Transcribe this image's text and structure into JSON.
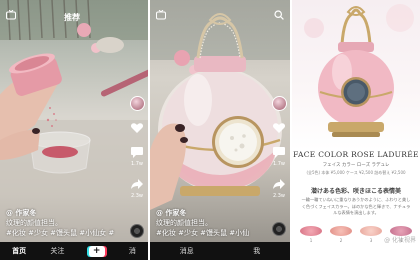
{
  "video1": {
    "top_tab_left": "推荐",
    "caption_author": "@ 作家冬",
    "caption_line1": "纹理的颜值担当。",
    "caption_tags": "#化妆 #少女 #馒头鼠 #小仙女 #",
    "comment_count": "1.7w",
    "share_count": "2.3w",
    "nav": {
      "home": "首页",
      "follow": "关注",
      "plus": "+",
      "msg": "消"
    }
  },
  "video2": {
    "caption_author": "@ 作家冬",
    "caption_line1": "纹理的颜值担当。",
    "caption_tags": "#化妆 #少女 #馒头鼠 #小仙",
    "comment_count": "1.7w",
    "share_count": "2.3w",
    "nav": {
      "msg": "消息",
      "me": "我"
    }
  },
  "product": {
    "title": "FACE COLOR ROSE LADURÉE",
    "subtitle": "フェイス カラー ローズ ラデュレ",
    "specs": "(全5色)  本体 ¥5,000  ケース ¥2,500  詰め替え ¥2,500",
    "headline": "潜けある色彩、咲きほこる表情美",
    "body": "一輪一輪ていねいに重なりあうかのように、ふわりと美しく色づくフェイスカラー。ほのかな色と輝きで、ナチュラルな表情を演出します。",
    "shades": [
      "1",
      "2",
      "3",
      "4"
    ],
    "watermark": "@ 化妆视界"
  },
  "colors": {
    "accent_pink": "#e8a3b1",
    "gold": "#c9a86a",
    "nav_bg": "#111111"
  }
}
